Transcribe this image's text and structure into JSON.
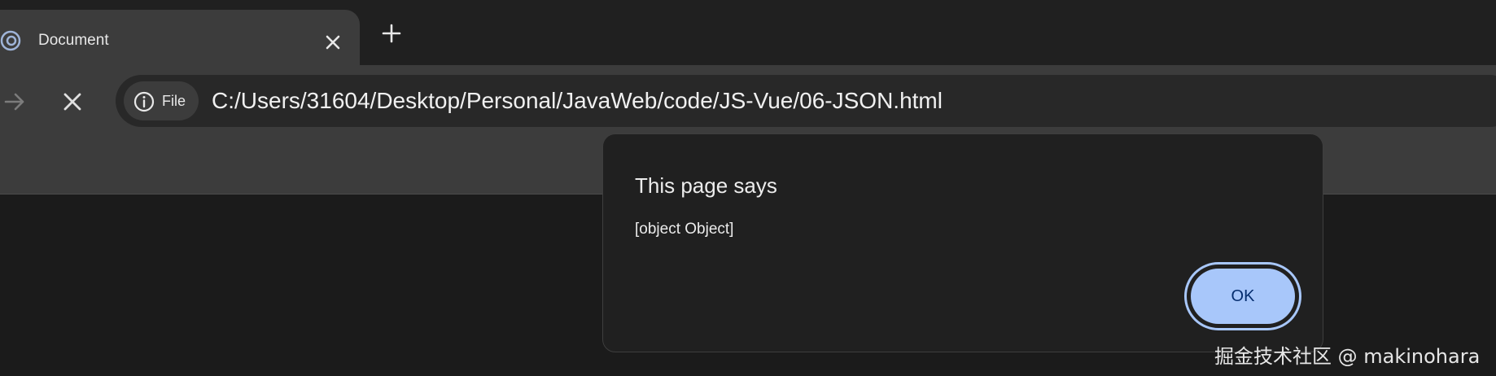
{
  "browser": {
    "tab": {
      "title": "Document",
      "favicon": "globe-favicon-icon",
      "close_icon": "close-icon"
    },
    "new_tab_icon": "plus-icon",
    "nav": {
      "forward_icon": "arrow-right-icon",
      "stop_icon": "close-icon"
    },
    "omnibox": {
      "chip_icon": "info-icon",
      "chip_label": "File",
      "url": "C:/Users/31604/Desktop/Personal/JavaWeb/code/JS-Vue/06-JSON.html"
    }
  },
  "dialog": {
    "title": "This page says",
    "message": "[object Object]",
    "ok_label": "OK"
  },
  "watermark": "掘金技术社区 @ makinohara",
  "colors": {
    "tabstrip_bg": "#202020",
    "toolbar_bg": "#3c3c3c",
    "page_bg": "#1b1b1b",
    "dialog_bg": "#202020",
    "accent": "#a8c7fa",
    "accent_text": "#062e6f"
  }
}
